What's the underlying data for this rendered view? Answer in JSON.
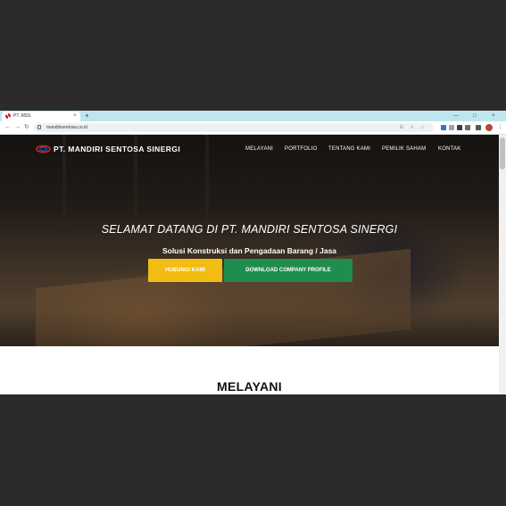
{
  "browser": {
    "tab_title": "PT. MSS",
    "tab_close": "×",
    "new_tab": "+",
    "url": "mandirisentosa.co.id",
    "controls": {
      "minimize": "—",
      "maximize": "□",
      "close": "×"
    }
  },
  "navbar": {
    "brand": "PT. MANDIRI SENTOSA SINERGI",
    "menu": [
      "MELAYANI",
      "PORTFOLIO",
      "TENTANG KAMI",
      "PEMILIK SAHAM",
      "KONTAK"
    ]
  },
  "hero": {
    "title": "SELAMAT DATANG DI PT. MANDIRI SENTOSA SINERGI",
    "subtitle": "Solusi Konstruksi dan Pengadaan Barang / Jasa",
    "primary_button": "HUBUNGI KAMI",
    "secondary_button": "DOWNLOAD COMPANY PROFILE"
  },
  "section": {
    "title": "MELAYANI"
  },
  "colors": {
    "tab_bar": "#bfe6ee",
    "primary_button": "#f2bc12",
    "secondary_button": "#1f8d4e",
    "logo_red": "#d81e2a",
    "logo_blue": "#1f5fb0"
  },
  "icons": {
    "favicon": "mss-logo-icon",
    "back": "arrow-left-icon",
    "forward": "arrow-right-icon",
    "reload": "reload-icon",
    "lock": "lock-icon",
    "star": "star-icon",
    "share": "share-icon",
    "extensions": "puzzle-icon",
    "menu": "kebab-menu-icon"
  }
}
